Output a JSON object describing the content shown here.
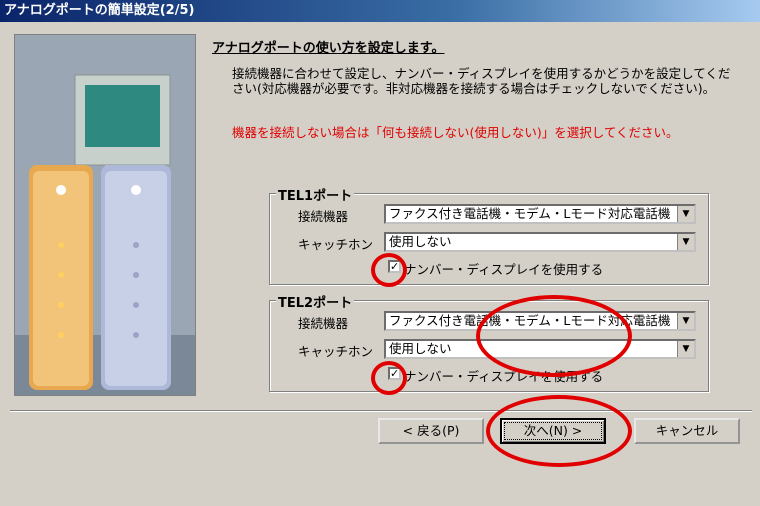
{
  "window": {
    "title": "アナログポートの簡単設定(2/5)"
  },
  "main": {
    "heading": "アナログポートの使い方を設定します。",
    "description": "接続機器に合わせて設定し、ナンバー・ディスプレイを使用するかどうかを設定してください(対応機器が必要です。非対応機器を接続する場合はチェックしないでください)。",
    "warning": "機器を接続しない場合は「何も接続しない(使用しない)」を選択してください。"
  },
  "tel1": {
    "title": "TEL1ポート",
    "device_label": "接続機器",
    "device_value": "ファクス付き電話機・モデム・Lモード対応電話機",
    "catch_label": "キャッチホン",
    "catch_value": "使用しない",
    "nd_label": "ナンバー・ディスプレイを使用する",
    "nd_checked": true
  },
  "tel2": {
    "title": "TEL2ポート",
    "device_label": "接続機器",
    "device_value": "ファクス付き電話機・モデム・Lモード対応電話機",
    "catch_label": "キャッチホン",
    "catch_value": "使用しない",
    "nd_label": "ナンバー・ディスプレイを使用する",
    "nd_checked": true
  },
  "buttons": {
    "back": "< 戻る(P)",
    "next": "次へ(N) >",
    "cancel": "キャンセル"
  },
  "colors": {
    "title_bar": "#0a246a",
    "warning": "#e00000",
    "annotation": "#e00000"
  }
}
